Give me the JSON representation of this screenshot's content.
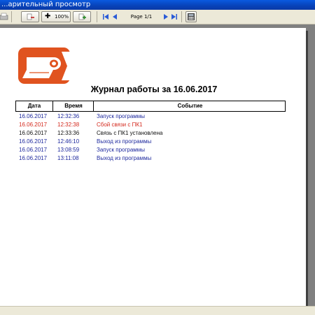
{
  "window": {
    "title": "...арительный просмотр"
  },
  "toolbar": {
    "zoom_label": "100%",
    "page_label": "Page 1/1"
  },
  "report": {
    "title": "Журнал работы за 16.06.2017",
    "columns": [
      "Дата",
      "Время",
      "Событие"
    ],
    "rows": [
      {
        "date": "16.06.2017",
        "time": "12:32:36",
        "event": "Запуск программы",
        "color": "#1f2a9e"
      },
      {
        "date": "16.06.2017",
        "time": "12:32:38",
        "event": "Сбой связи с ПК1",
        "color": "#d42a1e"
      },
      {
        "date": "16.06.2017",
        "time": "12:33:36",
        "event": "Связь с ПК1 установлена",
        "color": "#111111"
      },
      {
        "date": "16.06.2017",
        "time": "12:46:10",
        "event": "Выход из программы",
        "color": "#1f2a9e"
      },
      {
        "date": "16.06.2017",
        "time": "13:08:59",
        "event": "Запуск программы",
        "color": "#1f2a9e"
      },
      {
        "date": "16.06.2017",
        "time": "13:11:08",
        "event": "Выход из программы",
        "color": "#1f2a9e"
      }
    ]
  },
  "colors": {
    "logo_orange": "#e0531f",
    "event_blue": "#1f2a9e",
    "error_red": "#d42a1e"
  },
  "icons": [
    "printer-icon",
    "zoom-out-icon",
    "zoom-in-icon",
    "first-page-icon",
    "prev-page-icon",
    "next-page-icon",
    "last-page-icon",
    "calculator-icon"
  ]
}
